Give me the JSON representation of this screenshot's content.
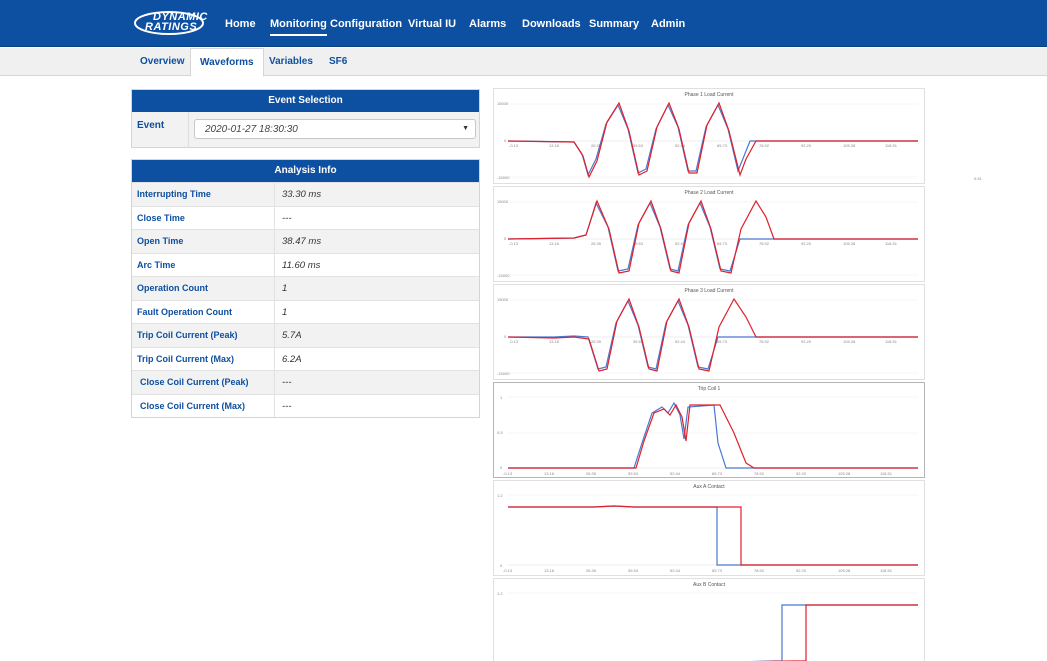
{
  "brand": {
    "line1": "DYNAMIC",
    "line2": "RATINGS"
  },
  "nav": {
    "items": [
      "Home",
      "Monitoring",
      "Configuration",
      "Virtual IU",
      "Alarms",
      "Downloads",
      "Summary",
      "Admin"
    ],
    "active": "Monitoring"
  },
  "subnav": {
    "tabs": [
      "Overview",
      "Waveforms",
      "Variables",
      "SF6"
    ],
    "active": "Waveforms"
  },
  "event_selection": {
    "title": "Event Selection",
    "label": "Event",
    "selected": "2020-01-27 18:30:30"
  },
  "analysis": {
    "title": "Analysis Info",
    "rows": [
      {
        "label": "Interrupting Time",
        "value": "33.30 ms"
      },
      {
        "label": "Close Time",
        "value": "---"
      },
      {
        "label": "Open Time",
        "value": "38.47 ms"
      },
      {
        "label": "Arc Time",
        "value": "11.60 ms"
      },
      {
        "label": "Operation Count",
        "value": "1"
      },
      {
        "label": "Fault Operation Count",
        "value": "1"
      },
      {
        "label": "Trip Coil Current (Peak)",
        "value": "5.7A"
      },
      {
        "label": "Trip Coil Current (Max)",
        "value": "6.2A"
      },
      {
        "label": "Close Coil Current (Peak)",
        "value": "---"
      },
      {
        "label": "Close Coil Current (Max)",
        "value": "---"
      }
    ]
  },
  "side_note": "0.51",
  "colors": {
    "nav_blue": "#0d4fa0",
    "series_blue": "#4a78d0",
    "series_red": "#e0202a"
  },
  "charts": [
    {
      "title": "Phase 1 Load Current",
      "y_ticks": [
        "15000",
        "0",
        "-15000"
      ],
      "x_ticks": [
        "-0.13",
        "13.16",
        "26.35",
        "39.53",
        "52.44",
        "65.73",
        "78.92",
        "92.20",
        "105.28",
        "118.51"
      ]
    },
    {
      "title": "Phase 2 Load Current",
      "y_ticks": [
        "15000",
        "0",
        "-15000"
      ],
      "x_ticks": [
        "-0.13",
        "13.16",
        "26.35",
        "39.53",
        "52.44",
        "65.73",
        "78.92",
        "92.20",
        "105.28",
        "118.51"
      ]
    },
    {
      "title": "Phase 3 Load Current",
      "y_ticks": [
        "15000",
        "0",
        "-15000"
      ],
      "x_ticks": [
        "-0.13",
        "13.16",
        "26.35",
        "39.53",
        "52.44",
        "65.73",
        "78.92",
        "92.20",
        "105.28",
        "118.51"
      ]
    },
    {
      "title": "Trip Coil 1",
      "y_ticks": [
        "1",
        "0.5",
        "0"
      ],
      "x_ticks": [
        "-0.13",
        "13.16",
        "26.35",
        "39.53",
        "52.44",
        "65.73",
        "78.92",
        "92.20",
        "105.28",
        "118.51"
      ]
    },
    {
      "title": "Aux A Contact",
      "y_ticks": [
        "1.2",
        "0"
      ],
      "x_ticks": [
        "-0.13",
        "13.16",
        "26.35",
        "39.53",
        "52.44",
        "65.73",
        "78.92",
        "92.20",
        "105.28",
        "118.51"
      ]
    },
    {
      "title": "Aux B Contact",
      "y_ticks": [
        "1.2"
      ],
      "x_ticks": []
    }
  ]
}
